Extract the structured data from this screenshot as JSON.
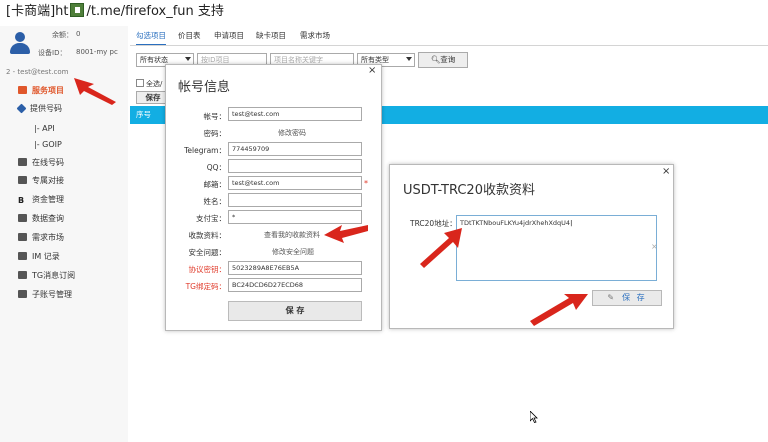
{
  "title": {
    "prefix": "[卡商端]ht",
    "suffix": "/t.me/firefox_fun 支持"
  },
  "sidebar": {
    "balance_label": "余额：",
    "balance_value": "0",
    "device_label": "设备ID：",
    "device_value": "8001-my pc",
    "user": "2 - test@test.com",
    "items": [
      {
        "label": "服务项目",
        "icon": "gift-icon",
        "active": true
      },
      {
        "label": "提供号码",
        "icon": "diamond-icon"
      },
      {
        "label": "|- API"
      },
      {
        "label": "|- GOIP"
      },
      {
        "label": "在线号码",
        "icon": "list-icon"
      },
      {
        "label": "专属对接",
        "icon": "link-icon"
      },
      {
        "label": "资金管理",
        "icon": "bitcoin-icon"
      },
      {
        "label": "数据查询",
        "icon": "table-icon"
      },
      {
        "label": "需求市场",
        "icon": "calendar-icon"
      },
      {
        "label": "IM 记录",
        "icon": "phone-icon"
      },
      {
        "label": "TG消息订阅",
        "icon": "bell-icon"
      },
      {
        "label": "子账号管理",
        "icon": "users-icon"
      }
    ]
  },
  "tabs": [
    "勾选项目",
    "价目表",
    "申请项目",
    "缺卡项目",
    "需求市场"
  ],
  "filter": {
    "status_value": "所有状态",
    "code_placeholder": "按ID项目",
    "name_placeholder": "项目名称关键字",
    "type_value": "所有类型",
    "search_label": "查询",
    "select_all_label": "全选/",
    "save_label": "保存"
  },
  "table": {
    "col_serial": "序号"
  },
  "account_dialog": {
    "title": "帐号信息",
    "close": "×",
    "fields": {
      "account_label": "帐号：",
      "account_value": "test@test.com",
      "password_label": "密码：",
      "password_link": "修改密码",
      "telegram_label": "Telegram：",
      "telegram_value": "774459709",
      "qq_label": "QQ：",
      "qq_value": "",
      "email_label": "邮箱：",
      "email_value": "test@test.com",
      "email_required": "*",
      "name_label": "姓名：",
      "name_value": "",
      "alipay_label": "支付宝：",
      "alipay_value": "*",
      "payment_label": "收款资料：",
      "payment_link": "查看我的收款资料",
      "security_label": "安全问题：",
      "security_link": "修改安全问题",
      "protocol_label": "协议密钥：",
      "protocol_value": "5023289A8E76EB5A",
      "tgbind_label": "TG绑定码：",
      "tgbind_value": "BC24DCD6D27ECD68"
    },
    "save_label": "保 存"
  },
  "usdt_dialog": {
    "title": "USDT-TRC20收款资料",
    "close": "×",
    "address_label": "TRC20地址：",
    "address_value": "TDtTKTNbouFLKYu4jdrXhehXdqU4",
    "clear": "×",
    "save_label": "保 存"
  },
  "colors": {
    "accent": "#12aee3",
    "active_item": "#e0572b",
    "annotation_arrow": "#d9261c",
    "link_blue": "#2a6fbf"
  }
}
